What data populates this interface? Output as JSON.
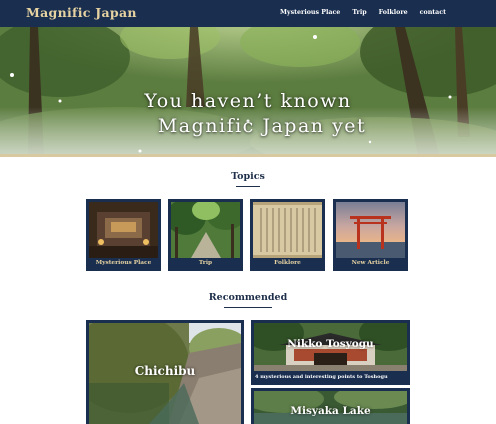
{
  "header": {
    "brand": "Magnific Japan",
    "nav": [
      "Mysterious Place",
      "Trip",
      "Folklore",
      "contact"
    ]
  },
  "hero": {
    "line1": "You haven’t known",
    "line2": "Magnific Japan yet"
  },
  "topics": {
    "title": "Topics",
    "cards": [
      {
        "label": "Mysterious Place"
      },
      {
        "label": "Trip"
      },
      {
        "label": "Folklore"
      },
      {
        "label": "New Article"
      }
    ]
  },
  "recommended": {
    "title": "Recommended",
    "cards": [
      {
        "title": "Chichibu",
        "subtitle": ""
      },
      {
        "title": "Nikko Tosyogu",
        "subtitle": "4 mysterious and interesting points to Toshogu"
      },
      {
        "title": "Misyaka Lake",
        "subtitle": ""
      }
    ]
  },
  "colors": {
    "navy": "#1a2f50",
    "gold": "#e7d3a2",
    "title_navy": "#1e2f49"
  }
}
